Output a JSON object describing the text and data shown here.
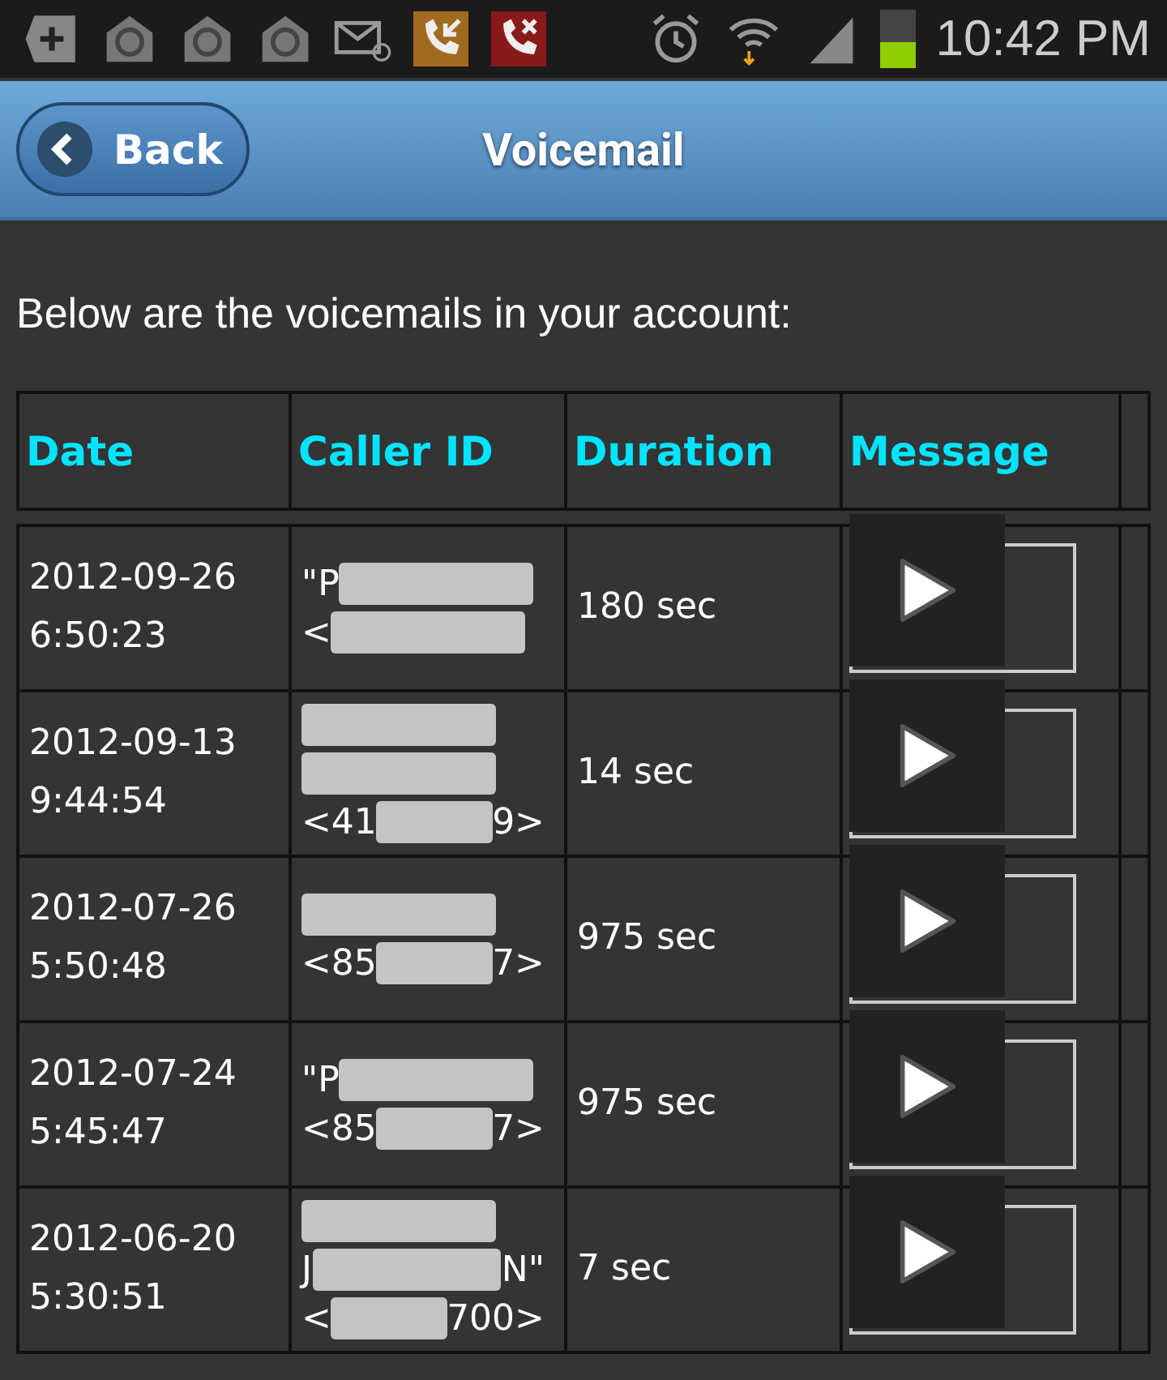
{
  "status_bar": {
    "time": "10:42 PM"
  },
  "header": {
    "back_button": "Back",
    "title": "Voicemail"
  },
  "intro": "Below are the voicemails in your account:",
  "table": {
    "columns": [
      "Date",
      "Caller ID",
      "Duration",
      "Message"
    ],
    "rows": [
      {
        "date": "2012-09-26",
        "time": "6:50:23",
        "caller_lines": [
          [
            {
              "kind": "text",
              "text": "\"P"
            },
            {
              "kind": "redacted"
            }
          ],
          [
            {
              "kind": "text",
              "text": "<"
            },
            {
              "kind": "redacted"
            }
          ]
        ],
        "duration": "180 sec"
      },
      {
        "date": "2012-09-13",
        "time": "9:44:54",
        "caller_lines": [
          [
            {
              "kind": "redacted"
            }
          ],
          [
            {
              "kind": "redacted"
            }
          ],
          [
            {
              "kind": "text",
              "text": "<41"
            },
            {
              "kind": "redacted"
            },
            {
              "kind": "text",
              "text": "9>"
            }
          ]
        ],
        "duration": "14 sec"
      },
      {
        "date": "2012-07-26",
        "time": "5:50:48",
        "caller_lines": [
          [
            {
              "kind": "redacted"
            }
          ],
          [
            {
              "kind": "text",
              "text": "<85"
            },
            {
              "kind": "redacted"
            },
            {
              "kind": "text",
              "text": "7>"
            }
          ]
        ],
        "duration": "975 sec"
      },
      {
        "date": "2012-07-24",
        "time": "5:45:47",
        "caller_lines": [
          [
            {
              "kind": "text",
              "text": "\"P"
            },
            {
              "kind": "redacted"
            }
          ],
          [
            {
              "kind": "text",
              "text": "<85"
            },
            {
              "kind": "redacted"
            },
            {
              "kind": "text",
              "text": "7>"
            }
          ]
        ],
        "duration": "975 sec"
      },
      {
        "date": "2012-06-20",
        "time": "5:30:51",
        "caller_lines": [
          [
            {
              "kind": "redacted"
            }
          ],
          [
            {
              "kind": "text",
              "text": "J"
            },
            {
              "kind": "redacted"
            },
            {
              "kind": "text",
              "text": "N\""
            }
          ],
          [
            {
              "kind": "text",
              "text": "<"
            },
            {
              "kind": "redacted"
            },
            {
              "kind": "text",
              "text": "700>"
            }
          ]
        ],
        "duration": "7 sec"
      }
    ]
  }
}
